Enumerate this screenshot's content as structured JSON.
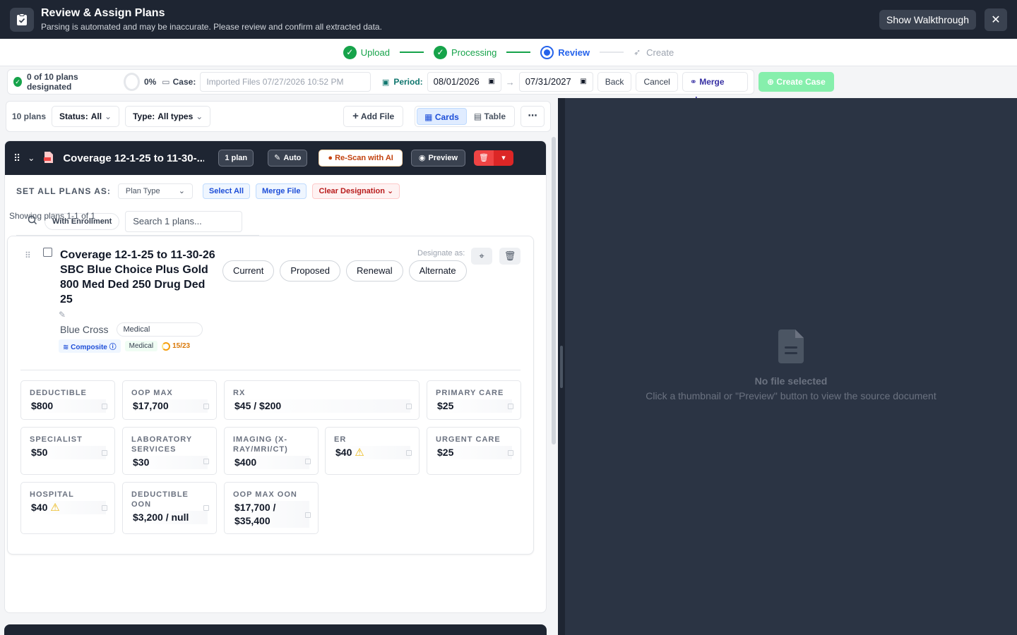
{
  "header": {
    "title": "Review & Assign Plans",
    "subtitle": "Parsing is automated and may be inaccurate. Please review and confirm all extracted data.",
    "walkthrough_label": "Show Walkthrough",
    "close_label": "✕"
  },
  "stepper": {
    "steps": [
      {
        "label": "Upload",
        "state": "done"
      },
      {
        "label": "Processing",
        "state": "done"
      },
      {
        "label": "Review",
        "state": "active"
      },
      {
        "label": "Create",
        "state": "pending"
      }
    ]
  },
  "toolbar": {
    "designated": "0 of 10 plans designated",
    "percent": "0%",
    "case_label": "Case:",
    "case_placeholder": "Imported Files 07/27/2026 10:52 PM",
    "period_label": "Period:",
    "period_start": "08/01/2026",
    "period_end": "07/31/2027",
    "back_label": "Back",
    "cancel_label": "Cancel",
    "merge_label": "Merge plans",
    "create_label": "Create Case"
  },
  "filters": {
    "count": "10 plans",
    "status_label": "Status:",
    "status_value": "All",
    "type_label": "Type:",
    "type_value": "All types",
    "add_file": "Add File",
    "view_cards": "Cards",
    "view_table": "Table",
    "more": "⋯"
  },
  "file": {
    "name": "Coverage 12-1-25 to 11-30-...",
    "plan_count": "1 plan",
    "auto_label": "Auto",
    "rescan_label": "Re-Scan with AI",
    "preview_label": "Preview",
    "set_all_label": "SET ALL PLANS AS:",
    "plan_type_placeholder": "Plan Type",
    "select_all": "Select All",
    "merge_file": "Merge File",
    "clear_designation": "Clear Designation",
    "with_enrollment": "With Enrollment",
    "search_placeholder": "Search 1 plans...",
    "showing": "Showing plans 1-1 of 1"
  },
  "plan": {
    "title": "Coverage 12-1-25 to 11-30-26 SBC Blue Choice Plus Gold 800 Med Ded 250 Drug Ded 25",
    "carrier": "Blue Cross",
    "line_of_coverage": "Medical",
    "rating": "Composite",
    "tag": "Medical",
    "fields_filled": "15/23",
    "designate_label": "Designate as:",
    "designations": [
      "Current",
      "Proposed",
      "Renewal",
      "Alternate"
    ],
    "benefits": [
      {
        "label": "DEDUCTIBLE",
        "value": "$800",
        "warn": false
      },
      {
        "label": "OOP MAX",
        "value": "$17,700",
        "warn": false
      },
      {
        "label": "RX",
        "value": "$45 / $200",
        "warn": false
      },
      {
        "label": "PRIMARY CARE",
        "value": "$25",
        "warn": false
      },
      {
        "label": "SPECIALIST",
        "value": "$50",
        "warn": false
      },
      {
        "label": "LABORATORY SERVICES",
        "value": "$30",
        "warn": false
      },
      {
        "label": "IMAGING (X-RAY/MRI/CT)",
        "value": "$400",
        "warn": false
      },
      {
        "label": "ER",
        "value": "$40",
        "warn": true
      },
      {
        "label": "URGENT CARE",
        "value": "$25",
        "warn": false
      },
      {
        "label": "HOSPITAL",
        "value": "$40",
        "warn": true
      },
      {
        "label": "DEDUCTIBLE OON",
        "value": "$3,200 / null",
        "warn": false
      },
      {
        "label": "OOP MAX OON",
        "value": "$17,700 / $35,400",
        "warn": false
      }
    ]
  },
  "preview": {
    "empty_title": "No file selected",
    "empty_sub": "Click a thumbnail or \"Preview\" button to view the source document"
  },
  "colors": {
    "header_bg": "#1e2532",
    "success": "#16a34a",
    "active": "#2563eb",
    "danger": "#ef4444",
    "preview_bg": "#2b3444"
  }
}
